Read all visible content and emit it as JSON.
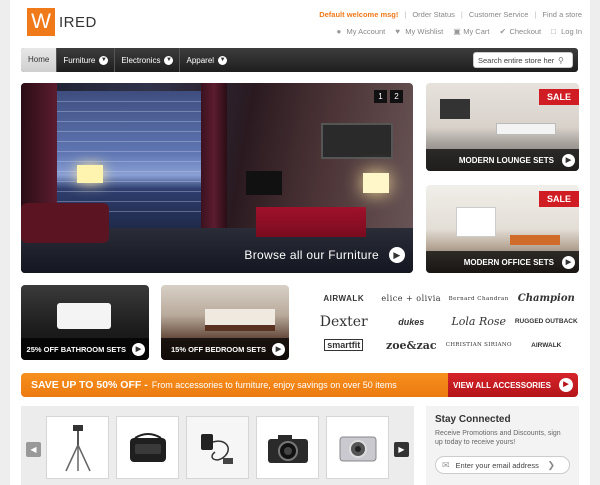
{
  "logo": {
    "letter": "W",
    "rest": "IRED"
  },
  "toplinks": {
    "welcome": "Default welcome msg!",
    "order_status": "Order Status",
    "customer_service": "Customer Service",
    "find_store": "Find a store"
  },
  "account": {
    "my_account": "My Account",
    "my_wishlist": "My Wishlist",
    "my_cart": "My Cart",
    "checkout": "Checkout",
    "login": "Log In"
  },
  "nav": {
    "home": "Home",
    "items": [
      "Furniture",
      "Electronics",
      "Apparel"
    ]
  },
  "search": {
    "placeholder": "Search entire store her"
  },
  "hero": {
    "cta": "Browse all our Furniture",
    "pages": [
      "1",
      "2"
    ]
  },
  "side": [
    {
      "badge": "SALE",
      "label": "MODERN LOUNGE SETS"
    },
    {
      "badge": "SALE",
      "label": "MODERN OFFICE SETS"
    }
  ],
  "promos": [
    {
      "label": "25% OFF BATHROOM SETS"
    },
    {
      "label": "15% OFF BEDROOM SETS"
    }
  ],
  "brands": [
    "AIRWALK",
    "elice + olivia",
    "Bernard Chandran",
    "Champion",
    "Dexter",
    "dukes",
    "Lola Rose",
    "RUGGED OUTBACK",
    "smartfit",
    "zoe&zac",
    "CHRISTIAN SIRIANO",
    "AIRWALK"
  ],
  "banner": {
    "bold": "SAVE UP TO 50% OFF -",
    "text": "From accessories to furniture, enjoy savings on over 50 items",
    "button": "VIEW ALL ACCESSORIES"
  },
  "carousel": {
    "items": [
      "tripod",
      "camera-bag",
      "charger",
      "dslr-camera",
      "compact-camera"
    ]
  },
  "connect": {
    "title": "Stay Connected",
    "text": "Receive Promotions and Discounts, sign up today to receive yours!",
    "email_placeholder": "Enter your email address"
  },
  "colors": {
    "accent": "#f07a1a",
    "sale": "#d01d24",
    "nav": "#2a2a2a"
  }
}
